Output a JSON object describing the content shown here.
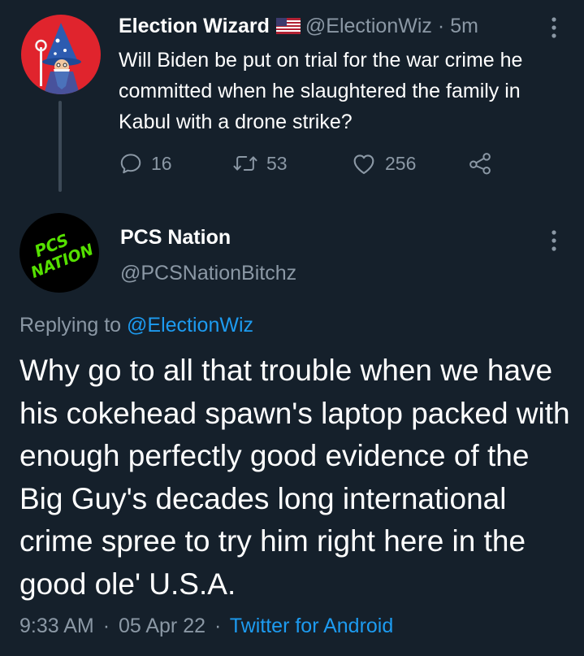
{
  "parent_tweet": {
    "author_name": "Election Wizard",
    "handle": "@ElectionWiz",
    "separator": "·",
    "time_ago": "5m",
    "text": "Will Biden be put on trial for the war crime he committed when he slaughtered the family in Kabul with a drone strike?",
    "actions": {
      "replies": "16",
      "retweets": "53",
      "likes": "256"
    }
  },
  "reply_tweet": {
    "author_name": "PCS Nation",
    "handle": "@PCSNationBitchz",
    "avatar_text": "PCS NATION",
    "replying_prefix": "Replying to",
    "replying_to": "@ElectionWiz",
    "text": "Why go to all that trouble when we have his cokehead spawn's laptop packed with enough perfectly good evidence of the Big Guy's decades long international crime spree to try him right here in the good ole' U.S.A.",
    "time": "9:33 AM",
    "date": "05 Apr 22",
    "separator": "·",
    "source": "Twitter for Android"
  },
  "icons": {
    "more": "more-vertical-icon",
    "reply": "comment-bubble-icon",
    "retweet": "retweet-icon",
    "like": "heart-icon",
    "share": "share-icon",
    "flag": "us-flag-icon"
  },
  "colors": {
    "background": "#15202b",
    "text": "#ffffff",
    "muted": "#8b98a5",
    "link": "#1d9bf0",
    "avatar1_bg": "#e0242d",
    "avatar2_bg": "#000000",
    "avatar2_text": "#55e000"
  }
}
